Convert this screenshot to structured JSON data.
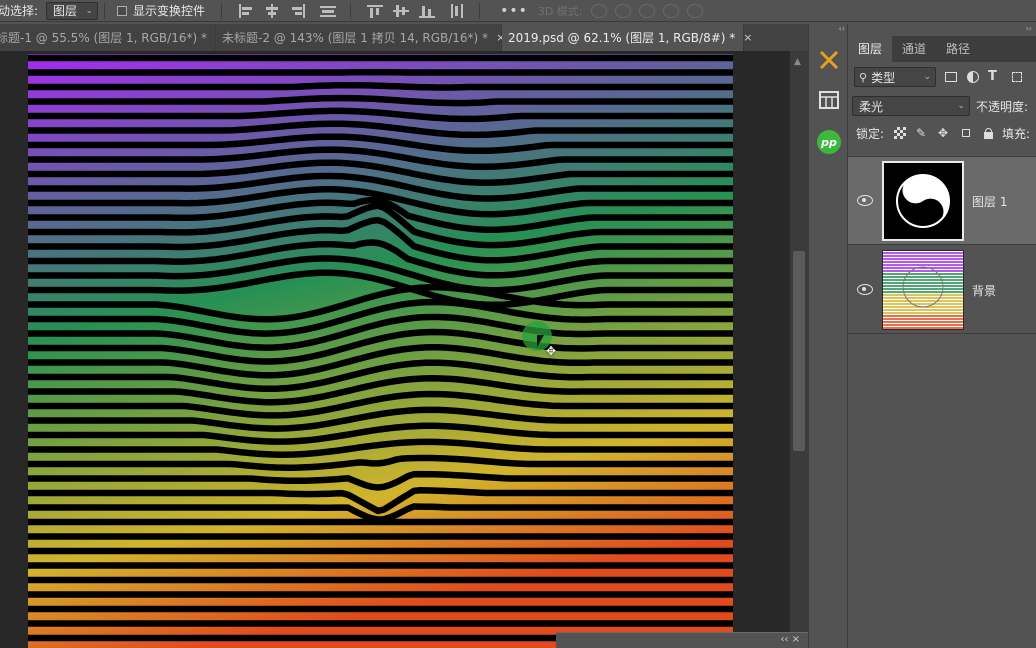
{
  "options_bar": {
    "auto_select_label": "动选择:",
    "layer_select_value": "图层",
    "show_transform_label": "显示变换控件",
    "more_label": "•••",
    "mode_3d_label": "3D 模式:"
  },
  "tabs": [
    {
      "title": "标题-1 @ 55.5% (图层 1, RGB/16*) *",
      "close": "×",
      "active": false
    },
    {
      "title": "未标题-2 @ 143% (图层 1 拷贝 14, RGB/16*) *",
      "close": "×",
      "active": false
    },
    {
      "title": "2019.psd @ 62.1% (图层 1, RGB/8#) *",
      "close": "×",
      "active": true
    }
  ],
  "tool_strip": {
    "items": [
      "brush-tools-icon",
      "grid-icon",
      "pp-plugin-icon"
    ],
    "pp_text": "pp",
    "collapse": "‹‹"
  },
  "panel": {
    "collapse": "››",
    "tabs": [
      "图层",
      "通道",
      "路径"
    ],
    "active_tab": 0,
    "filter_label": "类型",
    "blend_mode": "柔光",
    "opacity_label": "不透明度:",
    "lock_label": "锁定:",
    "fill_label": "填充:",
    "layers": [
      {
        "name": "图层 1",
        "selected": true,
        "visible": true,
        "thumb": "yin-yang"
      },
      {
        "name": "背景",
        "selected": false,
        "visible": true,
        "thumb": "stripes"
      }
    ]
  },
  "colors": {
    "gradient_top": "#a020f0",
    "gradient_mid": "#1a8a4a",
    "gradient_low": "#d0b020",
    "gradient_bottom": "#e04010",
    "stripe_light": "#ffffff",
    "stripe_dark": "#000000"
  },
  "float_panel": {
    "controls": "‹‹ ×"
  }
}
